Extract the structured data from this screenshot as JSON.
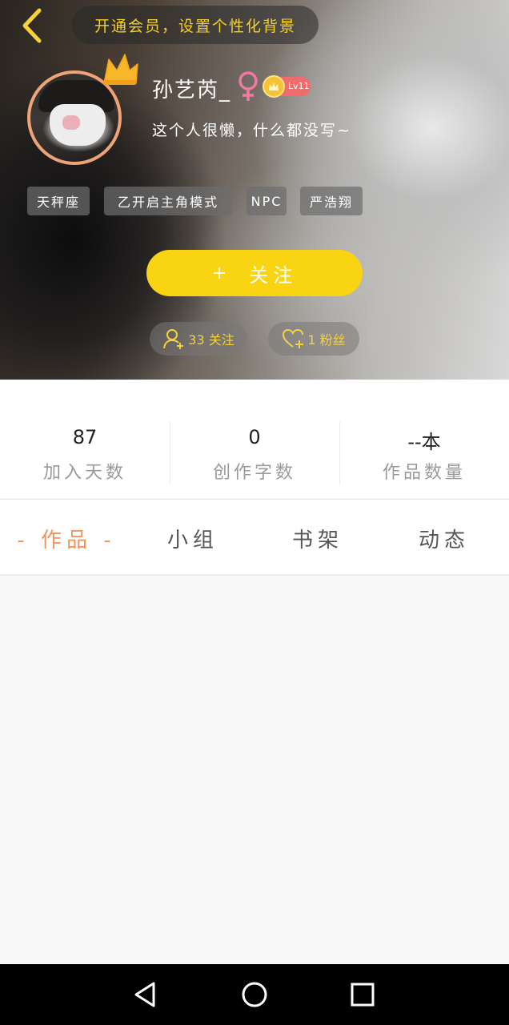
{
  "header": {
    "vip_banner": "开通会员，设置个性化背景",
    "nickname": "孙艺芮_",
    "level": "Lv11",
    "signature": "这个人很懒，什么都没写~",
    "tags": [
      "天秤座",
      "乙开启主角模式",
      "NPC",
      "严浩翔"
    ],
    "follow_button": {
      "plus": "+",
      "label": "关注"
    },
    "following_pill": "33 关注",
    "fans_pill": "1 粉丝",
    "colors": {
      "accent": "#f8d413",
      "avatar_border": "#f0a376",
      "gender": "#f07aa0",
      "level_badge": "#f06b6b"
    },
    "icons": [
      "back-arrow-icon",
      "crown-icon",
      "female-icon",
      "level-crown-icon",
      "person-add-icon",
      "heart-add-icon"
    ]
  },
  "stats": [
    {
      "value": "87",
      "label": "加入天数"
    },
    {
      "value": "0",
      "label": "创作字数"
    },
    {
      "value": "--本",
      "label": "作品数量"
    }
  ],
  "tabs": [
    {
      "label": "- 作品 -",
      "active": true
    },
    {
      "label": "小组",
      "active": false
    },
    {
      "label": "书架",
      "active": false
    },
    {
      "label": "动态",
      "active": false
    }
  ],
  "tab_active_color": "#f0955b",
  "navbar": {
    "icons": [
      "back-triangle-icon",
      "home-circle-icon",
      "recents-square-icon"
    ]
  }
}
